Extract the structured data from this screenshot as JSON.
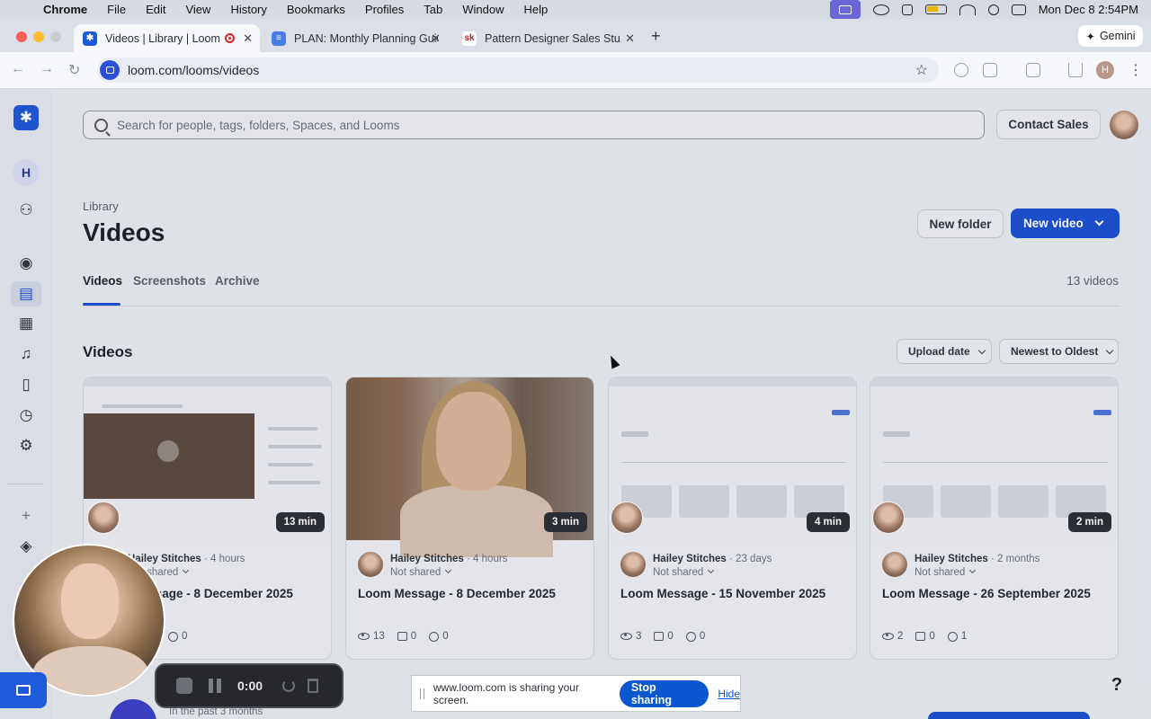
{
  "menubar": {
    "app": "Chrome",
    "items": [
      "File",
      "Edit",
      "View",
      "History",
      "Bookmarks",
      "Profiles",
      "Tab",
      "Window",
      "Help"
    ],
    "clock": "Mon Dec 8  2:54PM"
  },
  "browser": {
    "tabs": [
      {
        "title": "Videos | Library | Loom",
        "fav_color": "#1d56d6",
        "fav_glyph": "✱"
      },
      {
        "title": "PLAN: Monthly Planning Guid",
        "fav_color": "#4a7ee6",
        "fav_glyph": "≡"
      },
      {
        "title": "Pattern Designer Sales Studio",
        "fav_color": "#ffffff",
        "fav_glyph": "sk"
      }
    ],
    "new_tab": "+",
    "gemini": "Gemini",
    "url": "loom.com/looms/videos",
    "profile_initial": "H"
  },
  "sidebar": {
    "logo": "✱",
    "workspace_initial": "H"
  },
  "header": {
    "search_placeholder": "Search for people, tags, folders, Spaces, and Looms",
    "contact_sales": "Contact Sales"
  },
  "library": {
    "breadcrumb": "Library",
    "title": "Videos",
    "new_folder": "New folder",
    "new_video": "New video",
    "tabs": [
      "Videos",
      "Screenshots",
      "Archive"
    ],
    "count": "13 videos",
    "section_title": "Videos",
    "sort_field": "Upload date",
    "sort_order": "Newest to Oldest"
  },
  "videos": [
    {
      "duration": "13 min",
      "owner": "Hailey Stitches",
      "ago": "· 4 hours",
      "sharing": "Not shared",
      "title": "Loom Message - 8 December 2025",
      "views": "",
      "comments": "",
      "reactions": "0"
    },
    {
      "duration": "3 min",
      "owner": "Hailey Stitches",
      "ago": "· 4 hours",
      "sharing": "Not shared",
      "title": "Loom Message - 8 December 2025",
      "views": "13",
      "comments": "0",
      "reactions": "0"
    },
    {
      "duration": "4 min",
      "owner": "Hailey Stitches",
      "ago": "· 23 days",
      "sharing": "Not shared",
      "title": "Loom Message - 15 November 2025",
      "views": "3",
      "comments": "0",
      "reactions": "0"
    },
    {
      "duration": "2 min",
      "owner": "Hailey Stitches",
      "ago": "· 2 months",
      "sharing": "Not shared",
      "title": "Loom Message - 26 September 2025",
      "views": "2",
      "comments": "0",
      "reactions": "1"
    }
  ],
  "recorder": {
    "timer": "0:00"
  },
  "sharing_bar": {
    "message": "www.loom.com is sharing your screen.",
    "stop": "Stop sharing",
    "hide": "Hide"
  },
  "help": "?",
  "bottom_row": {
    "subtitle": "In the past 3 months"
  }
}
